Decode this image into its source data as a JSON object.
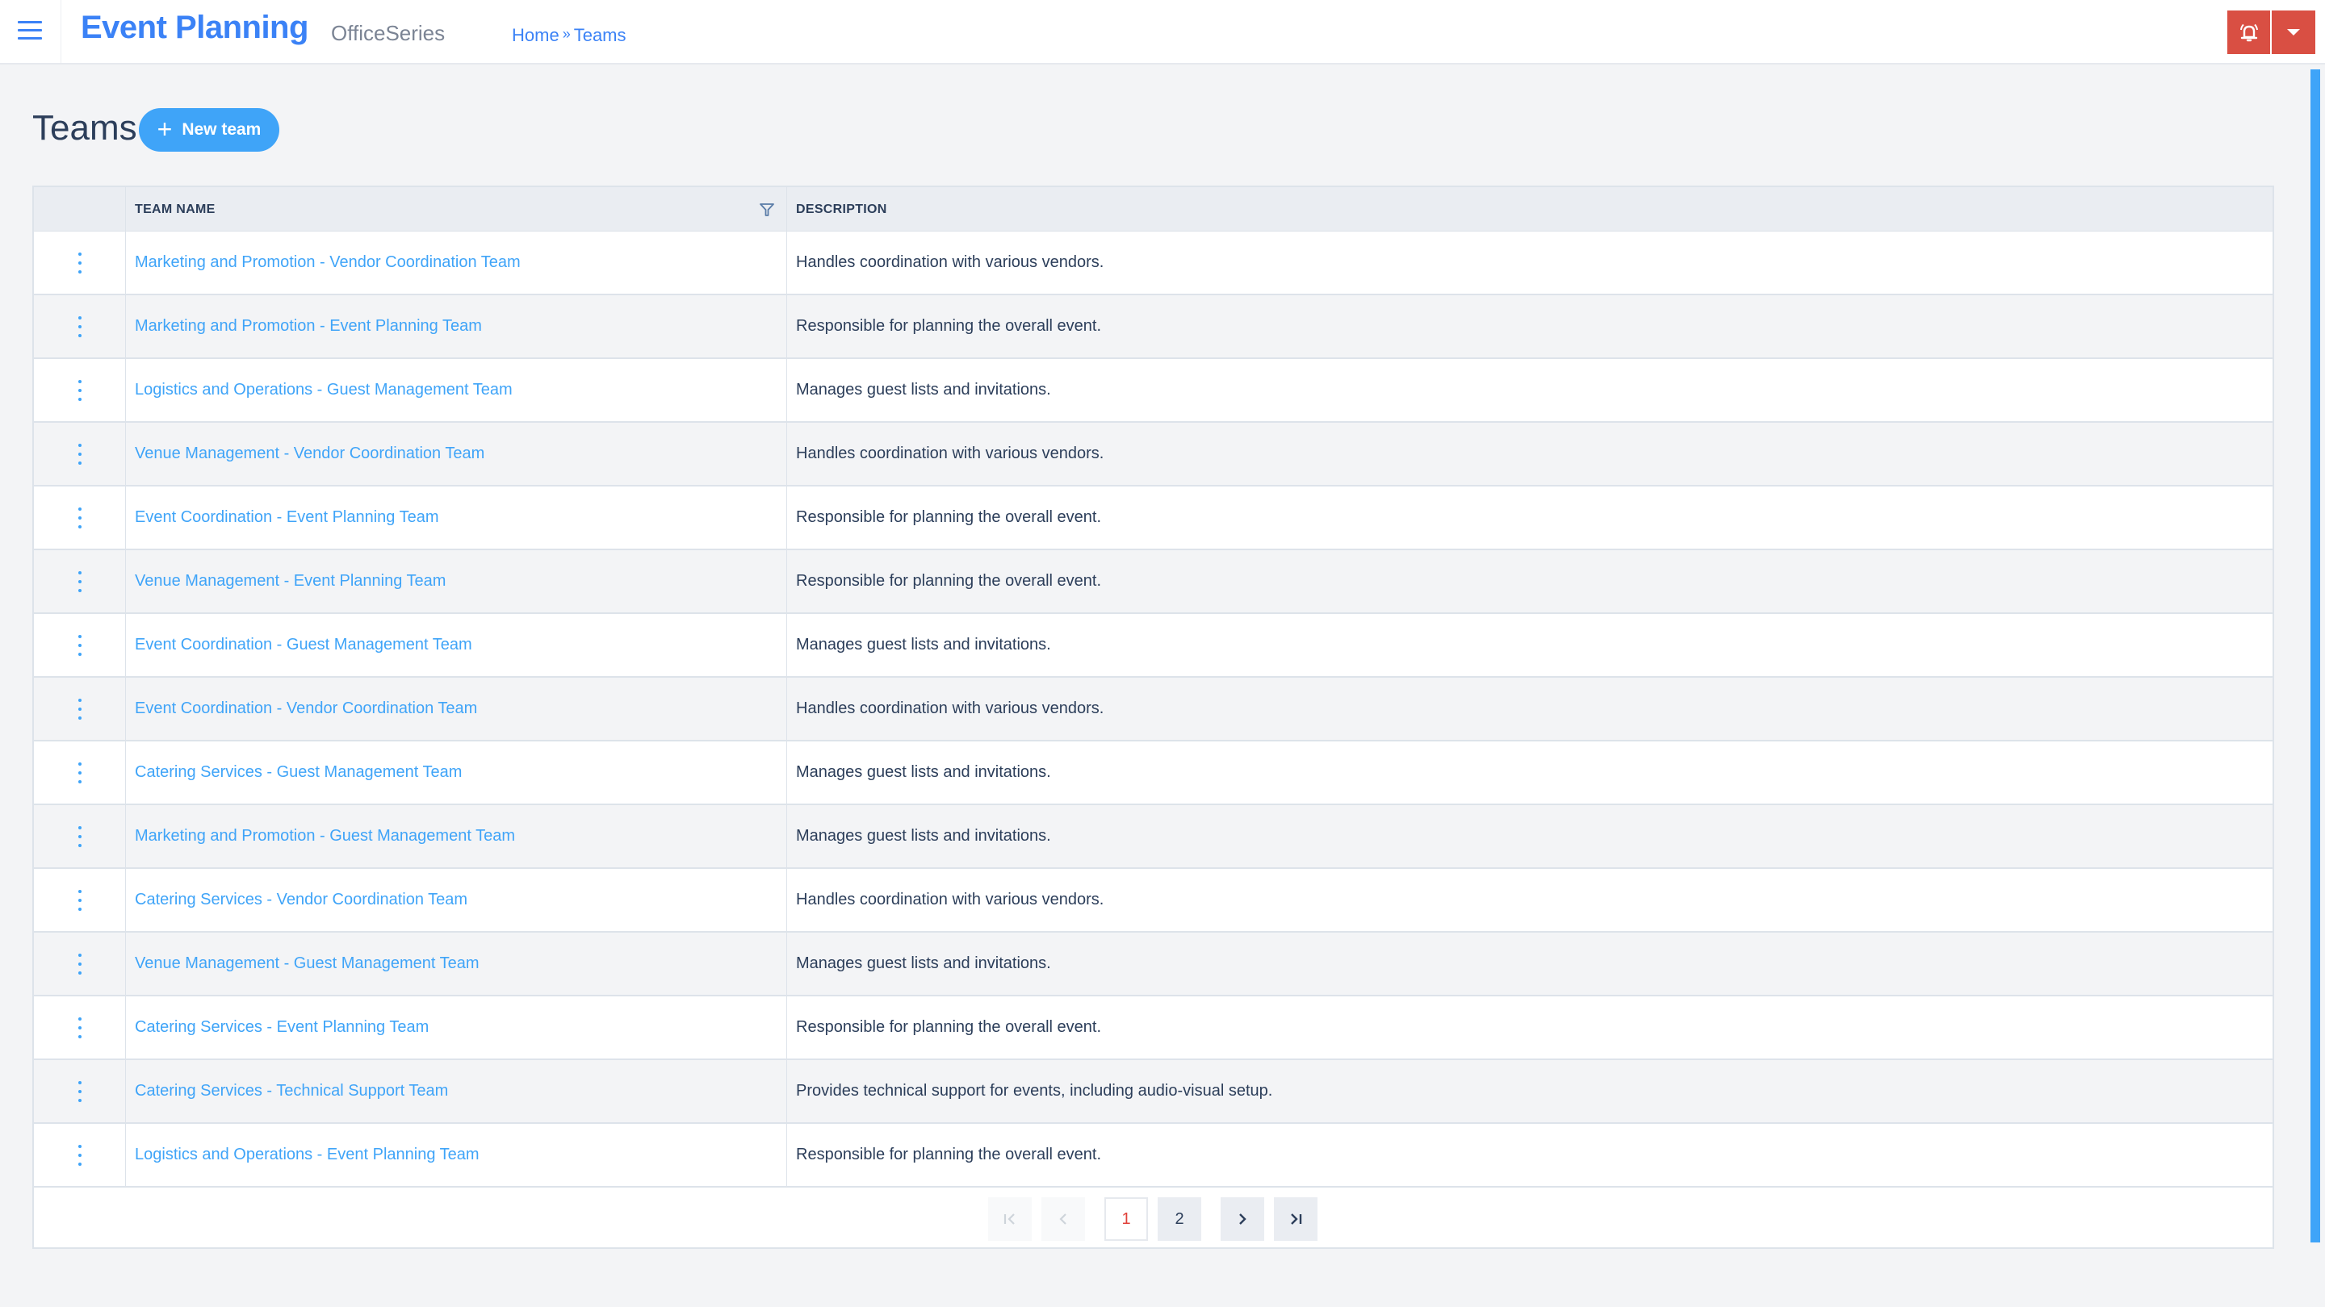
{
  "header": {
    "app_title": "Event Planning",
    "suite_name": "OfficeSeries",
    "breadcrumb": [
      {
        "label": "Home"
      },
      {
        "label": "Teams"
      }
    ],
    "breadcrumb_separator": "»",
    "menu_icon": "hamburger-icon",
    "notification_icon": "bell-icon",
    "dropdown_icon": "caret-down-icon",
    "action_color": "#d94f43",
    "accent_color": "#3b82f6"
  },
  "page": {
    "title": "Teams",
    "new_button_label": "New team",
    "new_button_icon": "plus-icon",
    "button_color": "#3fa4f8"
  },
  "table": {
    "columns": [
      {
        "label": ""
      },
      {
        "label": "TEAM NAME",
        "filter_icon": "filter-icon"
      },
      {
        "label": "DESCRIPTION"
      }
    ],
    "row_menu_icon": "kebab-menu-icon",
    "rows": [
      {
        "name": "Marketing and Promotion - Vendor Coordination Team",
        "description": "Handles coordination with various vendors."
      },
      {
        "name": "Marketing and Promotion - Event Planning Team",
        "description": "Responsible for planning the overall event."
      },
      {
        "name": "Logistics and Operations - Guest Management Team",
        "description": "Manages guest lists and invitations."
      },
      {
        "name": "Venue Management - Vendor Coordination Team",
        "description": "Handles coordination with various vendors."
      },
      {
        "name": "Event Coordination - Event Planning Team",
        "description": "Responsible for planning the overall event."
      },
      {
        "name": "Venue Management - Event Planning Team",
        "description": "Responsible for planning the overall event."
      },
      {
        "name": "Event Coordination - Guest Management Team",
        "description": "Manages guest lists and invitations."
      },
      {
        "name": "Event Coordination - Vendor Coordination Team",
        "description": "Handles coordination with various vendors."
      },
      {
        "name": "Catering Services - Guest Management Team",
        "description": "Manages guest lists and invitations."
      },
      {
        "name": "Marketing and Promotion - Guest Management Team",
        "description": "Manages guest lists and invitations."
      },
      {
        "name": "Catering Services - Vendor Coordination Team",
        "description": "Handles coordination with various vendors."
      },
      {
        "name": "Venue Management - Guest Management Team",
        "description": "Manages guest lists and invitations."
      },
      {
        "name": "Catering Services - Event Planning Team",
        "description": "Responsible for planning the overall event."
      },
      {
        "name": "Catering Services - Technical Support Team",
        "description": "Provides technical support for events, including audio-visual setup."
      },
      {
        "name": "Logistics and Operations - Event Planning Team",
        "description": "Responsible for planning the overall event."
      }
    ]
  },
  "pagination": {
    "first_label": "|<",
    "prev_label": "<",
    "pages": [
      "1",
      "2"
    ],
    "current_page": "1",
    "next_label": ">",
    "last_label": ">|",
    "active_color": "#e0413a"
  }
}
